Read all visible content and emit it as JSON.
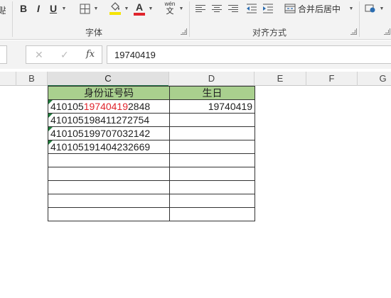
{
  "ribbon": {
    "font_group_label": "字体",
    "align_group_label": "对齐方式",
    "bold_label": "B",
    "italic_label": "I",
    "underline_label": "U",
    "font_color_label": "A",
    "font_color": "#e0242c",
    "fill_color": "#f5e400",
    "phonetic_top": "wén",
    "phonetic_bottom": "文",
    "merge_center_label": "合并后居中"
  },
  "formula_bar": {
    "cancel_icon": "✕",
    "enter_icon": "✓",
    "fx_label": "fx",
    "value": "19740419"
  },
  "columns": [
    "B",
    "C",
    "D",
    "E",
    "F",
    "G"
  ],
  "active_column": "C",
  "sheet": {
    "header_fill": "#a9d08e",
    "headers": [
      "身份证号码",
      "生日"
    ],
    "highlight_color": "#e0242c",
    "rows": [
      {
        "id_prefix": "410105",
        "id_highlight": "19740419",
        "id_suffix": "2848",
        "birthday": "19740419"
      },
      {
        "id_prefix": "410105198411272754",
        "id_highlight": "",
        "id_suffix": "",
        "birthday": ""
      },
      {
        "id_prefix": "410105199707032142",
        "id_highlight": "",
        "id_suffix": "",
        "birthday": ""
      },
      {
        "id_prefix": "410105191404232669",
        "id_highlight": "",
        "id_suffix": "",
        "birthday": ""
      },
      {
        "id_prefix": "",
        "id_highlight": "",
        "id_suffix": "",
        "birthday": ""
      },
      {
        "id_prefix": "",
        "id_highlight": "",
        "id_suffix": "",
        "birthday": ""
      },
      {
        "id_prefix": "",
        "id_highlight": "",
        "id_suffix": "",
        "birthday": ""
      },
      {
        "id_prefix": "",
        "id_highlight": "",
        "id_suffix": "",
        "birthday": ""
      },
      {
        "id_prefix": "",
        "id_highlight": "",
        "id_suffix": "",
        "birthday": ""
      }
    ]
  }
}
